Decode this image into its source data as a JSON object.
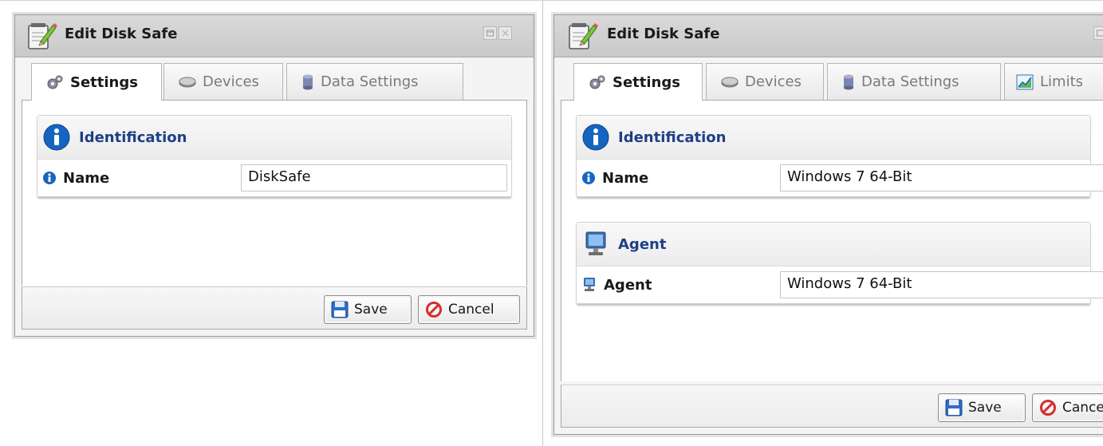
{
  "dialogs": [
    {
      "title": "Edit Disk Safe",
      "tabs": [
        {
          "label": "Settings",
          "icon": "gear-icon",
          "active": true
        },
        {
          "label": "Devices",
          "icon": "disk-icon",
          "active": false
        },
        {
          "label": "Data Settings",
          "icon": "database-icon",
          "active": false
        }
      ],
      "sections": [
        {
          "title": "Identification",
          "icon": "info-icon",
          "fields": [
            {
              "label": "Name",
              "value": "DiskSafe",
              "icon": "info-small-icon"
            }
          ]
        }
      ],
      "buttons": {
        "save": "Save",
        "cancel": "Cancel"
      }
    },
    {
      "title": "Edit Disk Safe",
      "tabs": [
        {
          "label": "Settings",
          "icon": "gear-icon",
          "active": true
        },
        {
          "label": "Devices",
          "icon": "disk-icon",
          "active": false
        },
        {
          "label": "Data Settings",
          "icon": "database-icon",
          "active": false
        },
        {
          "label": "Limits",
          "icon": "chart-icon",
          "active": false
        }
      ],
      "sections": [
        {
          "title": "Identification",
          "icon": "info-icon",
          "fields": [
            {
              "label": "Name",
              "value": "Windows 7 64-Bit",
              "icon": "info-small-icon"
            }
          ]
        },
        {
          "title": "Agent",
          "icon": "computer-icon",
          "fields": [
            {
              "label": "Agent",
              "value": "Windows 7 64-Bit",
              "icon": "computer-small-icon"
            }
          ]
        }
      ],
      "buttons": {
        "save": "Save",
        "cancel": "Cancel"
      }
    }
  ],
  "colors": {
    "section_title": "#1f3f86",
    "info_blue": "#1565c0",
    "cancel_red": "#d32f2f"
  }
}
